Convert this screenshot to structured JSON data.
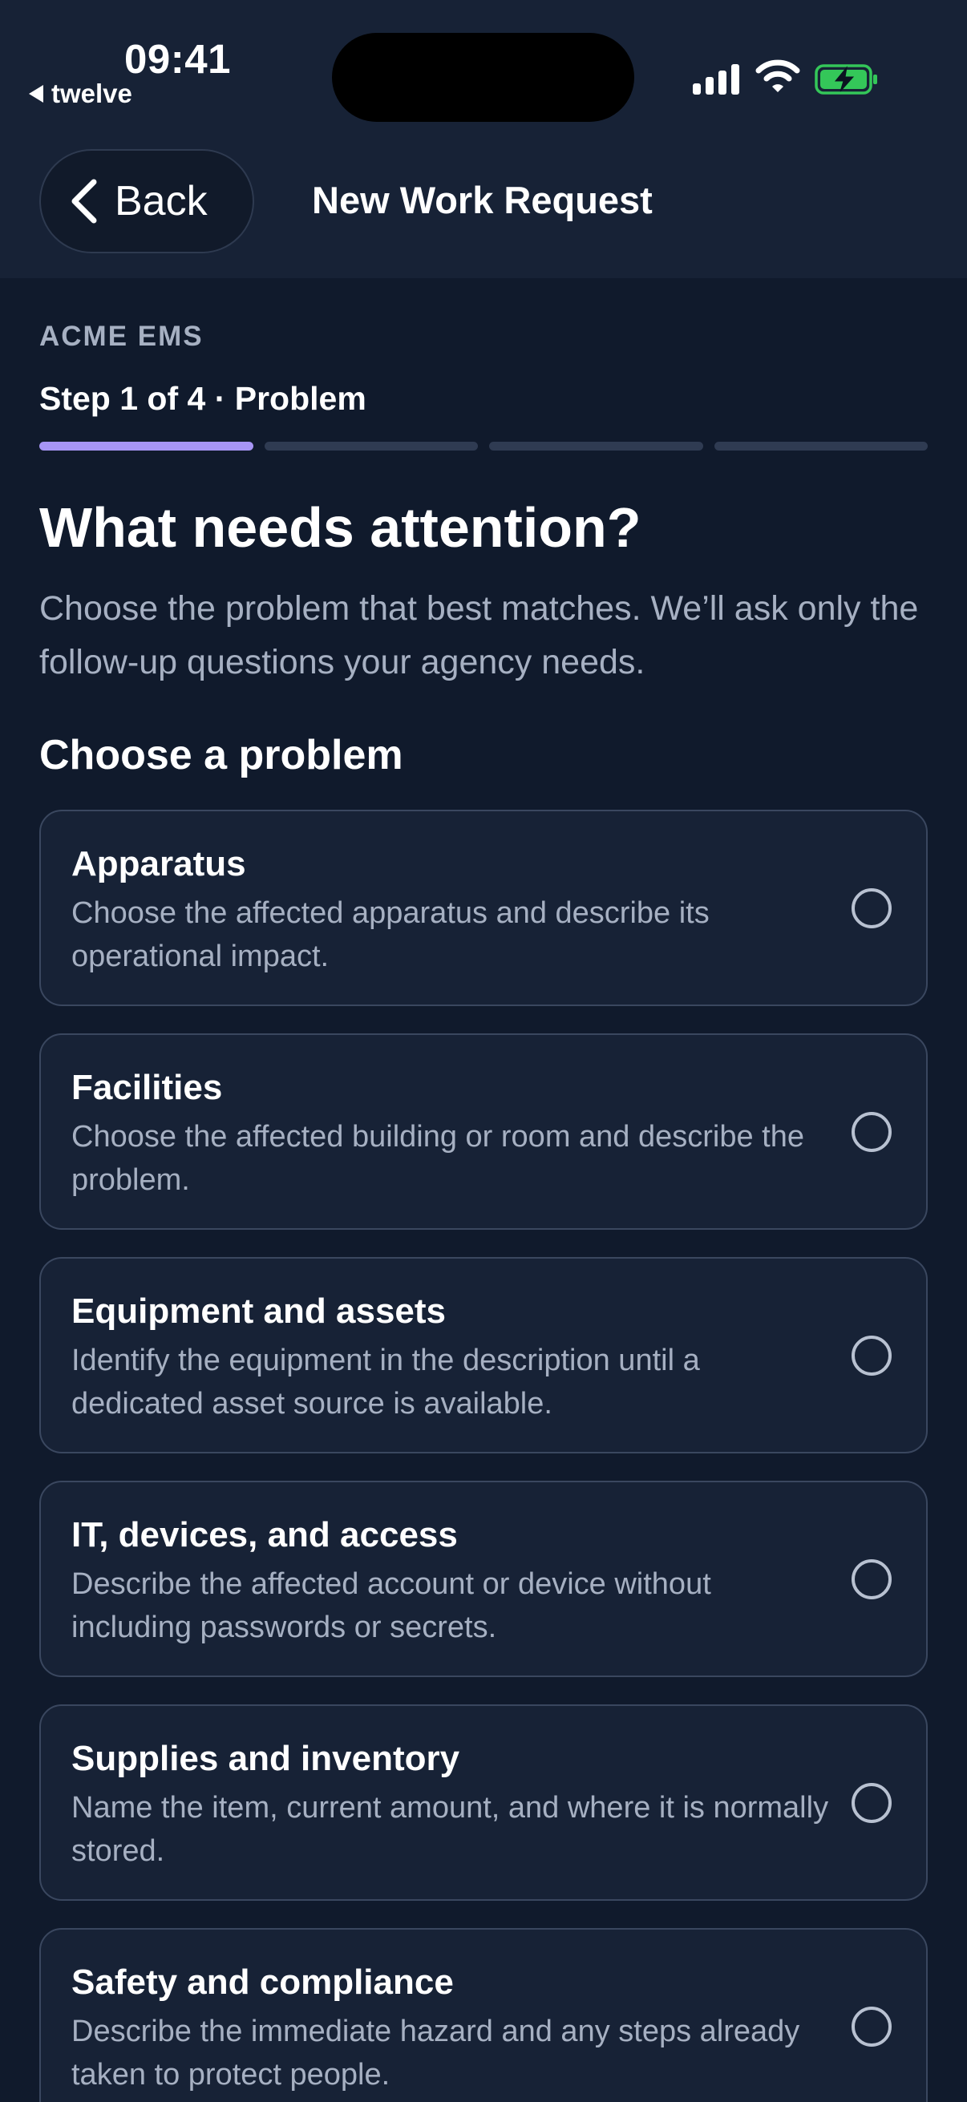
{
  "status_bar": {
    "time": "09:41",
    "back_app": "twelve"
  },
  "header": {
    "back_label": "Back",
    "title": "New Work Request"
  },
  "agency_name": "ACME EMS",
  "step": {
    "label": "Step 1 of 4 · Problem",
    "current": 1,
    "total": 4
  },
  "headline": "What needs attention?",
  "subtext": "Choose the problem that best matches. We’ll ask only the follow-up questions your agency needs.",
  "section_title": "Choose a problem",
  "options": [
    {
      "title": "Apparatus",
      "description": "Choose the affected apparatus and describe its operational impact.",
      "selected": false
    },
    {
      "title": "Facilities",
      "description": "Choose the affected building or room and describe the problem.",
      "selected": false
    },
    {
      "title": "Equipment and assets",
      "description": "Identify the equipment in the description until a dedicated asset source is available.",
      "selected": false
    },
    {
      "title": "IT, devices, and access",
      "description": "Describe the affected account or device without including passwords or secrets.",
      "selected": false
    },
    {
      "title": "Supplies and inventory",
      "description": "Name the item, current amount, and where it is normally stored.",
      "selected": false
    },
    {
      "title": "Safety and compliance",
      "description": "Describe the immediate hazard and any steps already taken to protect people.",
      "selected": false
    }
  ],
  "colors": {
    "background": "#101a2c",
    "surface": "#172236",
    "accent": "#a795f5",
    "muted_text": "#a6b0c2",
    "battery": "#34c759"
  }
}
